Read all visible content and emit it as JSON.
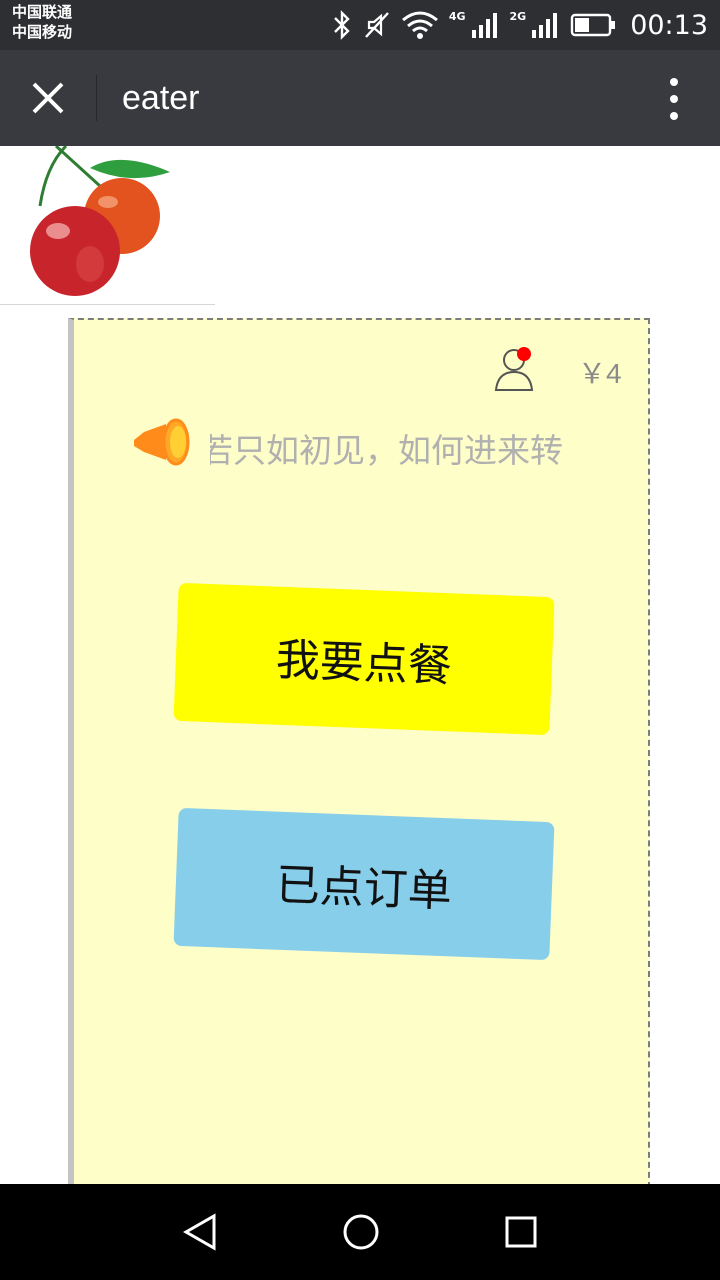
{
  "status_bar": {
    "carriers": [
      "中国联通",
      "中国移动"
    ],
    "network_labels": [
      "4G",
      "2G"
    ],
    "time": "00:13"
  },
  "title_bar": {
    "title": "eater",
    "close_icon": "close-icon",
    "more_icon": "more-vertical-icon"
  },
  "logo": {
    "icon": "cherry-logo"
  },
  "card": {
    "balance": "￥4",
    "marquee_text": "若只如初见，如何进来转",
    "buttons": {
      "order": "我要点餐",
      "my_orders": "已点订单"
    },
    "colors": {
      "background": "#fefec9",
      "order_button": "#ffff00",
      "orders_button": "#87ceeb",
      "notification_dot": "#ff0000"
    }
  },
  "nav": {
    "back_icon": "back-triangle-icon",
    "home_icon": "home-circle-icon",
    "recents_icon": "recents-square-icon"
  }
}
